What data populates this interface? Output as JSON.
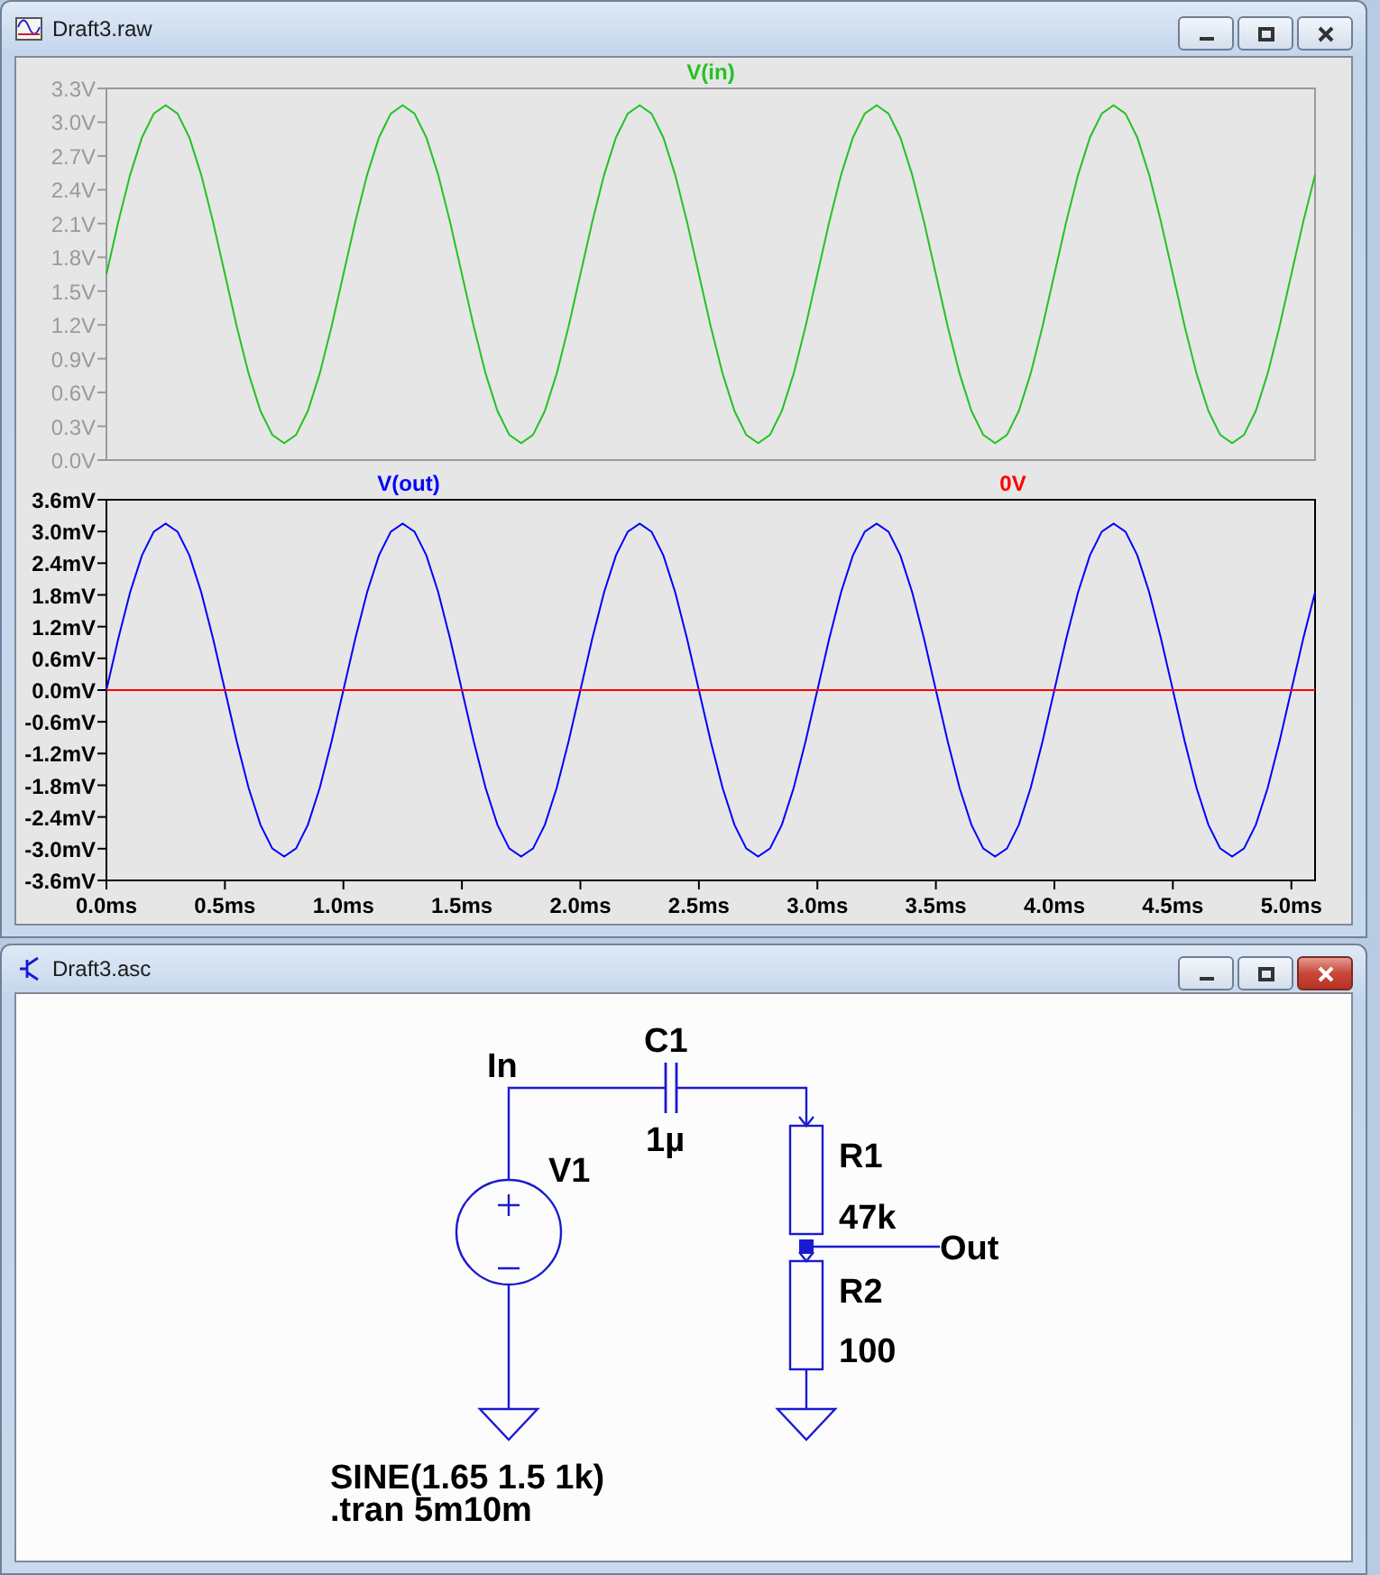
{
  "windows": [
    {
      "kind": "waveform",
      "title": "Draft3.raw",
      "active": false,
      "panes": [
        {
          "dimmed": true,
          "chart_data": {
            "type": "line",
            "xlim": [
              0,
              5.1
            ],
            "ylim": [
              0,
              3.3
            ],
            "yticks": [
              {
                "value": 0.0,
                "label": "0.0V"
              },
              {
                "value": 0.3,
                "label": "0.3V"
              },
              {
                "value": 0.6,
                "label": "0.6V"
              },
              {
                "value": 0.9,
                "label": "0.9V"
              },
              {
                "value": 1.2,
                "label": "1.2V"
              },
              {
                "value": 1.5,
                "label": "1.5V"
              },
              {
                "value": 1.8,
                "label": "1.8V"
              },
              {
                "value": 2.1,
                "label": "2.1V"
              },
              {
                "value": 2.4,
                "label": "2.4V"
              },
              {
                "value": 2.7,
                "label": "2.7V"
              },
              {
                "value": 3.0,
                "label": "3.0V"
              },
              {
                "value": 3.3,
                "label": "3.3V"
              }
            ],
            "x": [
              0,
              0.05,
              0.1,
              0.15,
              0.2,
              0.25,
              0.3,
              0.35,
              0.4,
              0.45,
              0.5,
              0.55,
              0.6,
              0.65,
              0.7,
              0.75,
              0.8,
              0.85,
              0.9,
              0.95,
              1,
              1.05,
              1.1,
              1.15,
              1.2,
              1.25,
              1.3,
              1.35,
              1.4,
              1.45,
              1.5,
              1.55,
              1.6,
              1.65,
              1.7,
              1.75,
              1.8,
              1.85,
              1.9,
              1.95,
              2,
              2.05,
              2.1,
              2.15,
              2.2,
              2.25,
              2.3,
              2.35,
              2.4,
              2.45,
              2.5,
              2.55,
              2.6,
              2.65,
              2.7,
              2.75,
              2.8,
              2.85,
              2.9,
              2.95,
              3,
              3.05,
              3.1,
              3.15,
              3.2,
              3.25,
              3.3,
              3.35,
              3.4,
              3.45,
              3.5,
              3.55,
              3.6,
              3.65,
              3.7,
              3.75,
              3.8,
              3.85,
              3.9,
              3.95,
              4,
              4.05,
              4.1,
              4.15,
              4.2,
              4.25,
              4.3,
              4.35,
              4.4,
              4.45,
              4.5,
              4.55,
              4.6,
              4.65,
              4.7,
              4.75,
              4.8,
              4.85,
              4.9,
              4.95,
              5,
              5.05,
              5.1
            ],
            "series": [
              {
                "name": "V(in)",
                "color": "#22c322",
                "values": [
                  1.65,
                  2.114,
                  2.532,
                  2.864,
                  3.077,
                  3.15,
                  3.077,
                  2.864,
                  2.532,
                  2.114,
                  1.65,
                  1.186,
                  0.768,
                  0.436,
                  0.223,
                  0.15,
                  0.223,
                  0.436,
                  0.768,
                  1.186,
                  1.65,
                  2.114,
                  2.532,
                  2.864,
                  3.077,
                  3.15,
                  3.077,
                  2.864,
                  2.532,
                  2.114,
                  1.65,
                  1.186,
                  0.768,
                  0.436,
                  0.223,
                  0.15,
                  0.223,
                  0.436,
                  0.768,
                  1.186,
                  1.65,
                  2.114,
                  2.532,
                  2.864,
                  3.077,
                  3.15,
                  3.077,
                  2.864,
                  2.532,
                  2.114,
                  1.65,
                  1.186,
                  0.768,
                  0.436,
                  0.223,
                  0.15,
                  0.223,
                  0.436,
                  0.768,
                  1.186,
                  1.65,
                  2.114,
                  2.532,
                  2.864,
                  3.077,
                  3.15,
                  3.077,
                  2.864,
                  2.532,
                  2.114,
                  1.65,
                  1.186,
                  0.768,
                  0.436,
                  0.223,
                  0.15,
                  0.223,
                  0.436,
                  0.768,
                  1.186,
                  1.65,
                  2.114,
                  2.532,
                  2.864,
                  3.077,
                  3.15,
                  3.077,
                  2.864,
                  2.532,
                  2.114,
                  1.65,
                  1.186,
                  0.768,
                  0.436,
                  0.223,
                  0.15,
                  0.223,
                  0.436,
                  0.768,
                  1.186,
                  1.65,
                  2.114,
                  2.532
                ]
              }
            ]
          }
        },
        {
          "dimmed": false,
          "chart_data": {
            "type": "line",
            "xlim": [
              0,
              5.1
            ],
            "ylim": [
              -3.6,
              3.6
            ],
            "xticks": [
              {
                "value": 0,
                "label": "0.0ms"
              },
              {
                "value": 0.5,
                "label": "0.5ms"
              },
              {
                "value": 1,
                "label": "1.0ms"
              },
              {
                "value": 1.5,
                "label": "1.5ms"
              },
              {
                "value": 2,
                "label": "2.0ms"
              },
              {
                "value": 2.5,
                "label": "2.5ms"
              },
              {
                "value": 3,
                "label": "3.0ms"
              },
              {
                "value": 3.5,
                "label": "3.5ms"
              },
              {
                "value": 4,
                "label": "4.0ms"
              },
              {
                "value": 4.5,
                "label": "4.5ms"
              },
              {
                "value": 5,
                "label": "5.0ms"
              }
            ],
            "yticks": [
              {
                "value": -3.6,
                "label": "-3.6mV"
              },
              {
                "value": -3.0,
                "label": "-3.0mV"
              },
              {
                "value": -2.4,
                "label": "-2.4mV"
              },
              {
                "value": -1.8,
                "label": "-1.8mV"
              },
              {
                "value": -1.2,
                "label": "-1.2mV"
              },
              {
                "value": -0.6,
                "label": "-0.6mV"
              },
              {
                "value": 0.0,
                "label": "0.0mV"
              },
              {
                "value": 0.6,
                "label": "0.6mV"
              },
              {
                "value": 1.2,
                "label": "1.2mV"
              },
              {
                "value": 1.8,
                "label": "1.8mV"
              },
              {
                "value": 2.4,
                "label": "2.4mV"
              },
              {
                "value": 3.0,
                "label": "3.0mV"
              },
              {
                "value": 3.6,
                "label": "3.6mV"
              }
            ],
            "x": [
              0,
              0.05,
              0.1,
              0.15,
              0.2,
              0.25,
              0.3,
              0.35,
              0.4,
              0.45,
              0.5,
              0.55,
              0.6,
              0.65,
              0.7,
              0.75,
              0.8,
              0.85,
              0.9,
              0.95,
              1,
              1.05,
              1.1,
              1.15,
              1.2,
              1.25,
              1.3,
              1.35,
              1.4,
              1.45,
              1.5,
              1.55,
              1.6,
              1.65,
              1.7,
              1.75,
              1.8,
              1.85,
              1.9,
              1.95,
              2,
              2.05,
              2.1,
              2.15,
              2.2,
              2.25,
              2.3,
              2.35,
              2.4,
              2.45,
              2.5,
              2.55,
              2.6,
              2.65,
              2.7,
              2.75,
              2.8,
              2.85,
              2.9,
              2.95,
              3,
              3.05,
              3.1,
              3.15,
              3.2,
              3.25,
              3.3,
              3.35,
              3.4,
              3.45,
              3.5,
              3.55,
              3.6,
              3.65,
              3.7,
              3.75,
              3.8,
              3.85,
              3.9,
              3.95,
              4,
              4.05,
              4.1,
              4.15,
              4.2,
              4.25,
              4.3,
              4.35,
              4.4,
              4.45,
              4.5,
              4.55,
              4.6,
              4.65,
              4.7,
              4.75,
              4.8,
              4.85,
              4.9,
              4.95,
              5,
              5.05,
              5.1
            ],
            "series": [
              {
                "name": "V(out)",
                "color": "#0000ff",
                "values": [
                  0,
                  0.973,
                  1.852,
                  2.548,
                  2.996,
                  3.15,
                  2.996,
                  2.548,
                  1.852,
                  0.973,
                  0,
                  -0.973,
                  -1.852,
                  -2.548,
                  -2.996,
                  -3.15,
                  -2.996,
                  -2.548,
                  -1.852,
                  -0.973,
                  0,
                  0.973,
                  1.852,
                  2.548,
                  2.996,
                  3.15,
                  2.996,
                  2.548,
                  1.852,
                  0.973,
                  0,
                  -0.973,
                  -1.852,
                  -2.548,
                  -2.996,
                  -3.15,
                  -2.996,
                  -2.548,
                  -1.852,
                  -0.973,
                  0,
                  0.973,
                  1.852,
                  2.548,
                  2.996,
                  3.15,
                  2.996,
                  2.548,
                  1.852,
                  0.973,
                  0,
                  -0.973,
                  -1.852,
                  -2.548,
                  -2.996,
                  -3.15,
                  -2.996,
                  -2.548,
                  -1.852,
                  -0.973,
                  0,
                  0.973,
                  1.852,
                  2.548,
                  2.996,
                  3.15,
                  2.996,
                  2.548,
                  1.852,
                  0.973,
                  0,
                  -0.973,
                  -1.852,
                  -2.548,
                  -2.996,
                  -3.15,
                  -2.996,
                  -2.548,
                  -1.852,
                  -0.973,
                  0,
                  0.973,
                  1.852,
                  2.548,
                  2.996,
                  3.15,
                  2.996,
                  2.548,
                  1.852,
                  0.973,
                  0,
                  -0.973,
                  -1.852,
                  -2.548,
                  -2.996,
                  -3.15,
                  -2.996,
                  -2.548,
                  -1.852,
                  -0.973,
                  0,
                  0.973,
                  1.852
                ]
              },
              {
                "name": "0V",
                "color": "#ff0000",
                "values": [
                  0,
                  0,
                  0,
                  0,
                  0,
                  0,
                  0,
                  0,
                  0,
                  0,
                  0,
                  0,
                  0,
                  0,
                  0,
                  0,
                  0,
                  0,
                  0,
                  0,
                  0,
                  0,
                  0,
                  0,
                  0,
                  0,
                  0,
                  0,
                  0,
                  0,
                  0,
                  0,
                  0,
                  0,
                  0,
                  0,
                  0,
                  0,
                  0,
                  0,
                  0,
                  0,
                  0,
                  0,
                  0,
                  0,
                  0,
                  0,
                  0,
                  0,
                  0,
                  0,
                  0,
                  0,
                  0,
                  0,
                  0,
                  0,
                  0,
                  0,
                  0,
                  0,
                  0,
                  0,
                  0,
                  0,
                  0,
                  0,
                  0,
                  0,
                  0,
                  0,
                  0,
                  0,
                  0,
                  0,
                  0,
                  0,
                  0,
                  0,
                  0,
                  0,
                  0,
                  0,
                  0,
                  0,
                  0,
                  0,
                  0,
                  0,
                  0,
                  0,
                  0,
                  0,
                  0,
                  0,
                  0,
                  0,
                  0,
                  0,
                  0,
                  0,
                  0
                ]
              }
            ]
          }
        }
      ]
    },
    {
      "kind": "schematic",
      "title": "Draft3.asc",
      "active": true,
      "schematic": {
        "net_labels": [
          "In",
          "Out"
        ],
        "components": [
          {
            "kind": "voltage_source",
            "ref": "V1",
            "value": "SINE(1.65 1.5 1k)"
          },
          {
            "kind": "capacitor",
            "ref": "C1",
            "value": "1µ"
          },
          {
            "kind": "resistor",
            "ref": "R1",
            "value": "47k"
          },
          {
            "kind": "resistor",
            "ref": "R2",
            "value": "100"
          }
        ],
        "directives": [
          ".tran 5m10m"
        ]
      }
    }
  ]
}
